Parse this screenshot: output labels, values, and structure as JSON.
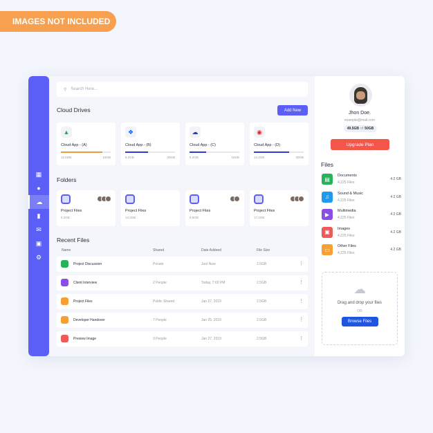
{
  "banner": "IMAGES NOT INCLUDED",
  "colors": {
    "accent": "#5b5ff5",
    "upgrade": "#f4564a"
  },
  "sidebar": {
    "items": [
      {
        "icon": "dashboard-icon"
      },
      {
        "icon": "user-icon"
      },
      {
        "icon": "cloud-icon",
        "active": true
      },
      {
        "icon": "chart-icon"
      },
      {
        "icon": "mail-icon"
      },
      {
        "icon": "chat-icon"
      },
      {
        "icon": "gear-icon"
      }
    ]
  },
  "search": {
    "placeholder": "Search Here..."
  },
  "cloud": {
    "title": "Cloud Drives",
    "add_label": "Add New",
    "drives": [
      {
        "name": "Cloud App - (A)",
        "used": "12.5GB",
        "total": "15GB",
        "percent": 83,
        "color": "#f09a35",
        "icon": "google-drive-icon"
      },
      {
        "name": "Cloud App - (B)",
        "used": "9.2GB",
        "total": "20GB",
        "percent": 46,
        "color": "#2b3bd4",
        "icon": "dropbox-icon"
      },
      {
        "name": "Cloud App - (C)",
        "used": "5.2GB",
        "total": "15GB",
        "percent": 33,
        "color": "#2b3bd4",
        "icon": "onedrive-icon"
      },
      {
        "name": "Cloud App - (D)",
        "used": "14.2GB",
        "total": "20GB",
        "percent": 71,
        "color": "#2b3bd4",
        "icon": "mega-icon"
      }
    ]
  },
  "folders": {
    "title": "Folders",
    "items": [
      {
        "name": "Project Files",
        "size": "5.2GB",
        "avatars": 3
      },
      {
        "name": "Project Files",
        "size": "14.2GB",
        "avatars": 0
      },
      {
        "name": "Project Files",
        "size": "9.5GB",
        "avatars": 2
      },
      {
        "name": "Project Files",
        "size": "17.2GB",
        "avatars": 3
      }
    ]
  },
  "recent": {
    "title": "Recent Files",
    "headers": [
      "Name",
      "Shared",
      "Date Addeed",
      "File Size"
    ],
    "rows": [
      {
        "name": "Project Discussion",
        "shared": "Private",
        "date": "Just Now",
        "size": "2.5GB",
        "color": "#27b35a"
      },
      {
        "name": "Client Interview",
        "shared": "2 People",
        "date": "Today, 7:00 PM",
        "size": "2.5GB",
        "color": "#8a4de8"
      },
      {
        "name": "Project Files",
        "shared": "Public Shared",
        "date": "Jan 27, 2019",
        "size": "2.5GB",
        "color": "#f6a033"
      },
      {
        "name": "Developer Handover",
        "shared": "7 People",
        "date": "Jan 25, 2019",
        "size": "2.5GB",
        "color": "#f6a033"
      },
      {
        "name": "Preview Image",
        "shared": "3 People",
        "date": "Jan 27, 2019",
        "size": "2.5GB",
        "color": "#ee5a5a"
      }
    ]
  },
  "profile": {
    "name": "Jhon Doe.",
    "email": "example@mail.com",
    "used": "49.5GB",
    "of": "of",
    "total": "50GB",
    "upgrade": "Upgrade Plan"
  },
  "files": {
    "title": "Files",
    "items": [
      {
        "name": "Documents",
        "count": "4,225 Files",
        "size": "4.2 GB",
        "color": "#27b35a",
        "icon": "document-icon"
      },
      {
        "name": "Sound & Music",
        "count": "4,225 Files",
        "size": "4.2 GB",
        "color": "#1e9bf0",
        "icon": "music-icon"
      },
      {
        "name": "Multimedia",
        "count": "4,225 Files",
        "size": "4.2 GB",
        "color": "#8a4de8",
        "icon": "play-icon"
      },
      {
        "name": "Images",
        "count": "4,225 Files",
        "size": "4.2 GB",
        "color": "#ee5a5a",
        "icon": "image-icon"
      },
      {
        "name": "Other Files",
        "count": "4,225 Files",
        "size": "4.2 GB",
        "color": "#f6a033",
        "icon": "folder-icon"
      }
    ]
  },
  "upload": {
    "text": "Drag and drop your files",
    "or": "OR",
    "browse": "Browse Files"
  }
}
